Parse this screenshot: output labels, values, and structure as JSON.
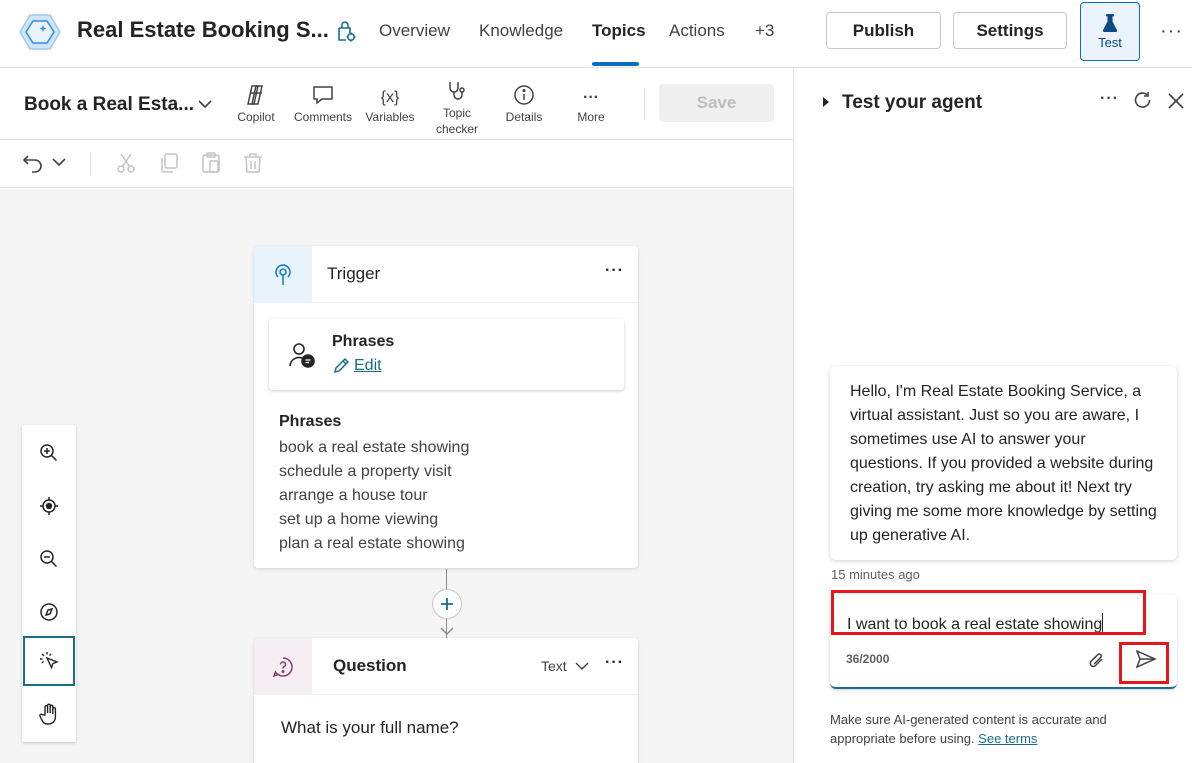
{
  "header": {
    "app_title": "Real Estate Booking S...",
    "tabs": [
      {
        "label": "Overview"
      },
      {
        "label": "Knowledge"
      },
      {
        "label": "Topics",
        "active": true
      },
      {
        "label": "Actions"
      },
      {
        "label": "+3"
      }
    ],
    "publish_label": "Publish",
    "settings_label": "Settings",
    "test_label": "Test",
    "more_label": "···"
  },
  "toolbar": {
    "topic_name": "Book a Real Esta...",
    "tools": [
      {
        "label": "Copilot",
        "icon": "copilot-icon"
      },
      {
        "label": "Comments",
        "icon": "comment-icon"
      },
      {
        "label": "Variables",
        "icon": "variables-icon"
      },
      {
        "label": "Topic checker",
        "icon": "stethoscope-icon"
      },
      {
        "label": "Details",
        "icon": "info-icon"
      },
      {
        "label": "More",
        "icon": "more-icon"
      }
    ],
    "variables_glyph": "{x}",
    "more_glyph": "···",
    "save_label": "Save"
  },
  "editbar": {
    "icons": [
      "undo-icon",
      "chevron-down-icon",
      "cut-icon",
      "copy-icon",
      "paste-icon",
      "delete-icon"
    ]
  },
  "canvas": {
    "trigger": {
      "title": "Trigger",
      "more": "···",
      "phrases_card_title": "Phrases",
      "edit_label": "Edit",
      "phrases_label": "Phrases",
      "phrases": [
        "book a real estate showing",
        "schedule a property visit",
        "arrange a house tour",
        "set up a home viewing",
        "plan a real estate showing"
      ]
    },
    "question": {
      "title": "Question",
      "type_label": "Text",
      "more": "···",
      "text": "What is your full name?"
    },
    "zoom_controls": [
      "zoom-in-icon",
      "recenter-icon",
      "zoom-out-icon",
      "minimap-icon",
      "select-pointer-icon",
      "pan-hand-icon"
    ]
  },
  "test_panel": {
    "title": "Test your agent",
    "more": "···",
    "bot_message": "Hello, I'm Real Estate Booking Service, a virtual assistant. Just so you are aware, I sometimes use AI to answer your questions. If you provided a website during creation, try asking me about it! Next try giving me some more knowledge by setting up generative AI.",
    "timestamp": "15 minutes ago",
    "input_value": "I want to book a real estate showing",
    "char_count": "36/2000",
    "disclaimer": "Make sure AI-generated content is accurate and appropriate before using.",
    "see_terms": "See terms"
  },
  "colors": {
    "accent": "#0f6cbd",
    "teal": "#1a6d8a",
    "highlight": "#e8161b"
  }
}
